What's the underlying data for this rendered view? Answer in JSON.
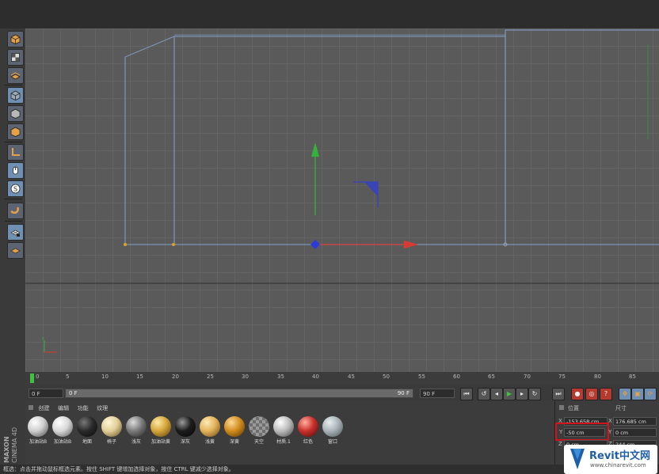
{
  "timeline": {
    "ticks": [
      "0",
      "5",
      "10",
      "15",
      "20",
      "25",
      "30",
      "35",
      "40",
      "45",
      "50",
      "55",
      "60",
      "65",
      "70",
      "75",
      "80",
      "85"
    ]
  },
  "playbar": {
    "current_frame": "0 F",
    "range_start": "0 F",
    "range_end": "90 F",
    "max_frame": "90 F"
  },
  "materials": {
    "tabs": [
      "创建",
      "编辑",
      "功能",
      "纹理"
    ],
    "items": [
      {
        "label": "加油站B",
        "color": "#cfcfcf"
      },
      {
        "label": "加油站B",
        "color": "#d8d8d8"
      },
      {
        "label": "地面",
        "color": "#2a2a2a"
      },
      {
        "label": "椅子",
        "color": "#e2cf97"
      },
      {
        "label": "浅灰",
        "color": "#7a7a7a"
      },
      {
        "label": "加油站黄",
        "color": "#d4a63a"
      },
      {
        "label": "深灰",
        "color": "#1c1c1c"
      },
      {
        "label": "浅黄",
        "color": "#e2b35a"
      },
      {
        "label": "深黄",
        "color": "#d18c1e"
      },
      {
        "label": "天空",
        "color": "#8a8a8a"
      },
      {
        "label": "材质.1",
        "color": "#bcbcbc"
      },
      {
        "label": "红色",
        "color": "#c8302a"
      },
      {
        "label": "窗口",
        "color": "#a9b3b8"
      }
    ]
  },
  "attributes": {
    "header_pos": "位置",
    "header_size": "尺寸",
    "x_label": "X",
    "y_label": "Y",
    "z_label": "Z",
    "pos_x": "-153.658 cm",
    "pos_y": "-50 cm",
    "pos_z": "0 cm",
    "size_x": "176.685 cm",
    "size_y": "0 cm",
    "size_z": "244 cm"
  },
  "status": {
    "text": "框选：点击并拖动鼠标框选元素。按住 SHIFT 键增加选择对象，按住 CTRL 键减少选择对象。"
  },
  "branding": {
    "vendor": "MAXON",
    "product": "CINEMA 4D",
    "watermark_title": "Revit中文网",
    "watermark_url": "www.chinarevit.com"
  },
  "icons": [
    "cube-icon",
    "checker-cube-icon",
    "texture-icon",
    "object-cube-icon",
    "model-cube-icon",
    "point-cube-icon",
    "corner-axis-icon",
    "mouse-icon",
    "snap-s-icon",
    "magnet-icon",
    "grid-lock-icon",
    "workplane-icon"
  ],
  "colors": {
    "accent": "#6f8fb3",
    "highlight_box": "#d4141c",
    "spline": "#7d95b8",
    "axis_x": "#d93a32",
    "axis_y": "#33b33a",
    "axis_center": "#2b3bd9"
  }
}
